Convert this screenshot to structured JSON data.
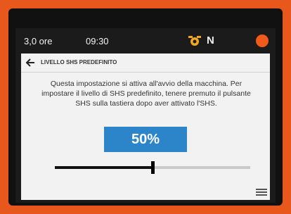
{
  "status_bar": {
    "hours": "3,0 ore",
    "time": "09:30",
    "gear_icon": "gear-warning-icon",
    "gear": "N",
    "alert_icon": "alert-indicator-icon",
    "accent_color": "#f05a1a"
  },
  "header": {
    "back_icon": "back-arrow-icon",
    "title": "LIVELLO SHS PREDEFINITO"
  },
  "description": "Questa impostazione si attiva all'avvio della macchina. Per impostare il livello di SHS predefinito, tenere premuto il pulsante SHS sulla tastiera dopo aver attivato l'SHS.",
  "level": {
    "label": "50%",
    "value": 0.5
  },
  "menu_icon": "menu-icon",
  "colors": {
    "value_box": "#2d85c9",
    "panel": "#f2f2f2",
    "frame": "#e8581c"
  }
}
